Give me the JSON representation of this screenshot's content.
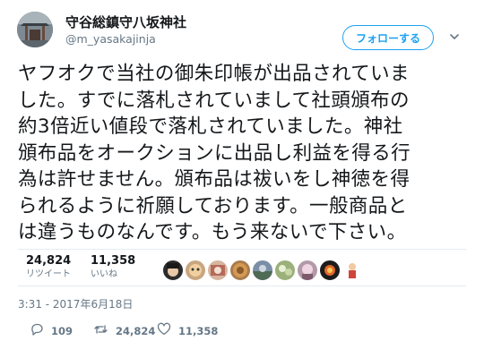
{
  "account": {
    "display_name": "守谷総鎮守八坂神社",
    "handle": "@m_yasakajinja",
    "follow_label": "フォローする"
  },
  "tweet": {
    "lines": [
      "ヤフオクで当社の御朱印帳が出品されていま",
      "した。すでに落札されていまして社頭頒布の",
      "約3倍近い値段で落札されていました。神社",
      "頒布品をオークションに出品し利益を得る行",
      "為は許せません。頒布品は祓いをし神徳を得",
      "られるように祈願しております。一般商品と",
      "は違うものなんです。もう来ないで下さい。"
    ]
  },
  "stats": {
    "retweets_count": "24,824",
    "retweets_label": "リツイート",
    "likes_count": "11,358",
    "likes_label": "いいね"
  },
  "timestamp": "3:31 - 2017年6月18日",
  "actions": {
    "reply_count": "109",
    "retweet_count": "24,824",
    "like_count": "11,358"
  },
  "colors": {
    "accent": "#1da1f2",
    "text": "#14171a",
    "secondary": "#657786",
    "divider": "#e6ecf0"
  },
  "icons": [
    "chevron-down-icon",
    "reply-icon",
    "retweet-icon",
    "heart-icon"
  ]
}
